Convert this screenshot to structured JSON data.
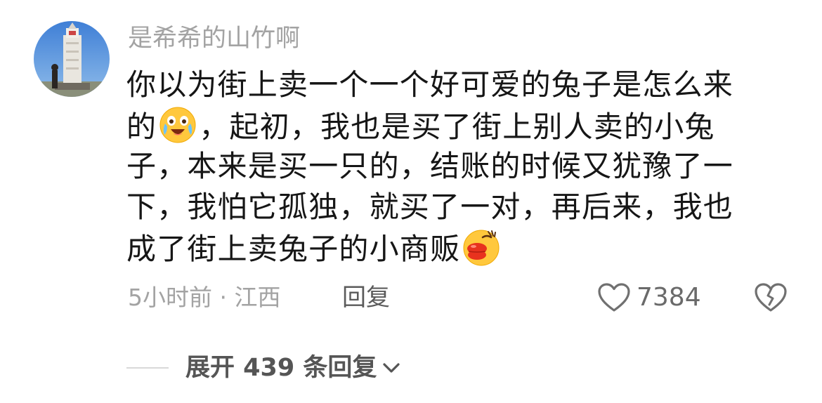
{
  "comment": {
    "username": "是希希的山竹啊",
    "lines": [
      {
        "before": "你以为街上卖一个一个好可爱的兔子是怎么来",
        "after": ""
      },
      {
        "before": "的",
        "after": "，起初，我也是买了街上别人卖的小兔"
      },
      {
        "before": "子，本来是买一只的，结账的时候又犹豫了一",
        "after": ""
      },
      {
        "before": "下，我怕它孤独，就买了一对，再后来，我也",
        "after": ""
      },
      {
        "before": "成了街上卖兔子的小商贩",
        "after": ""
      }
    ],
    "emojis": [
      "laughing-crying-emoji",
      "kiss-face-emoji"
    ],
    "time_location": "5小时前 · 江西",
    "reply_label": "回复",
    "like_count": "7384",
    "expand_label": "展开 439 条回复"
  },
  "icons": {
    "like": "heart-outline-icon",
    "dislike": "broken-heart-icon",
    "expand": "chevron-down-icon"
  },
  "colors": {
    "username": "#a3a3a3",
    "text": "#161616",
    "meta": "#a3a3a3",
    "accent_gray": "#555555",
    "emoji_yellow": "#ffc83d"
  }
}
